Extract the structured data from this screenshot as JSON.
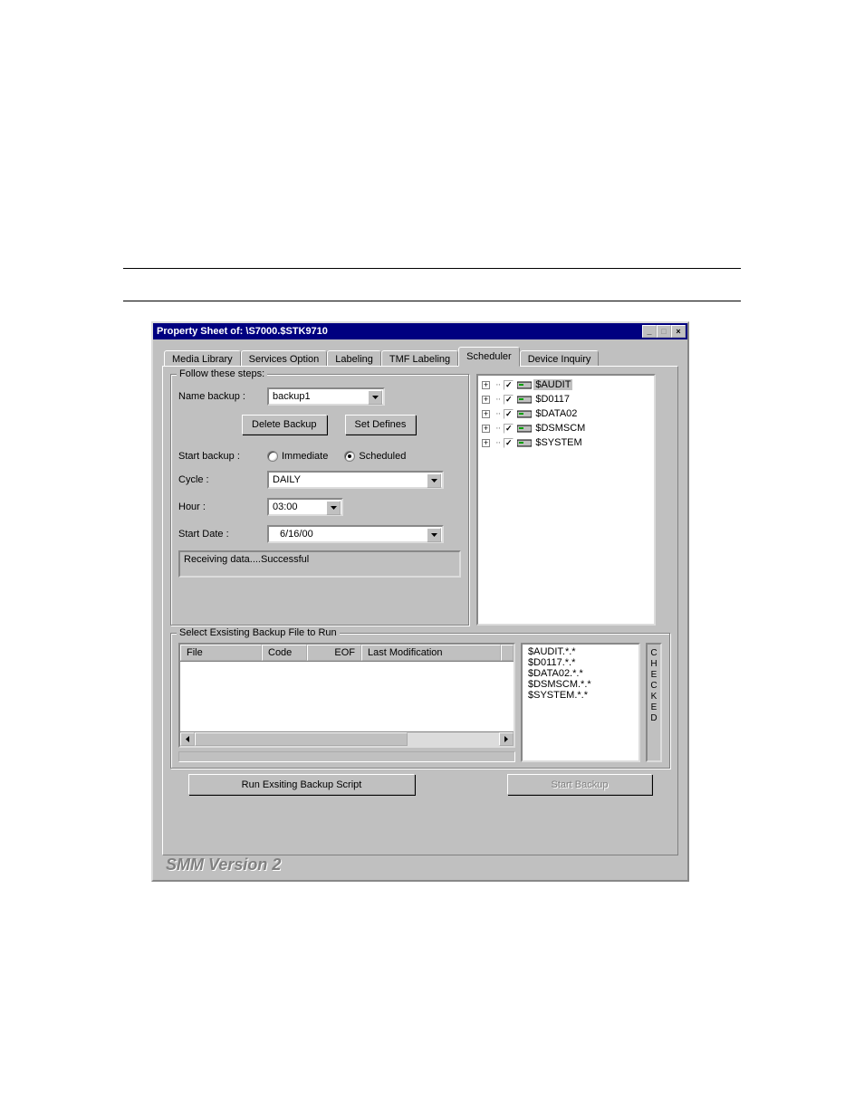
{
  "window": {
    "title": "Property Sheet of: \\S7000.$STK9710"
  },
  "tabs": {
    "items": [
      "Media Library",
      "Services Option",
      "Labeling",
      "TMF Labeling",
      "Scheduler",
      "Device Inquiry"
    ],
    "active_index": 4
  },
  "steps": {
    "legend": "Follow these steps:",
    "name_label": "Name backup :",
    "name_value": "backup1",
    "delete_btn": "Delete Backup",
    "set_defines_btn": "Set Defines",
    "start_label": "Start backup :",
    "radio_immediate": "Immediate",
    "radio_scheduled": "Scheduled",
    "radio_selected": "scheduled",
    "cycle_label": "Cycle :",
    "cycle_value": "DAILY",
    "hour_label": "Hour :",
    "hour_value": "03:00",
    "date_label": "Start Date :",
    "date_value": "6/16/00",
    "status_text": "Receiving data....Successful"
  },
  "tree": {
    "items": [
      {
        "label": "$AUDIT",
        "checked": true,
        "selected": true
      },
      {
        "label": "$D0117",
        "checked": true,
        "selected": false
      },
      {
        "label": "$DATA02",
        "checked": true,
        "selected": false
      },
      {
        "label": "$DSMSCM",
        "checked": true,
        "selected": false
      },
      {
        "label": "$SYSTEM",
        "checked": true,
        "selected": false
      }
    ]
  },
  "existing": {
    "legend": "Select Exsisting Backup File to Run",
    "cols": {
      "file": "File",
      "code": "Code",
      "eof": "EOF",
      "lastmod": "Last Modification"
    },
    "checked_label": "CHECKED",
    "checked_items": [
      "$AUDIT.*.*",
      "$D0117.*.*",
      "$DATA02.*.*",
      "$DSMSCM.*.*",
      "$SYSTEM.*.*"
    ]
  },
  "buttons": {
    "run_existing": "Run Exsiting Backup Script",
    "start_backup": "Start Backup"
  },
  "footer": {
    "version": "SMM Version 2"
  }
}
